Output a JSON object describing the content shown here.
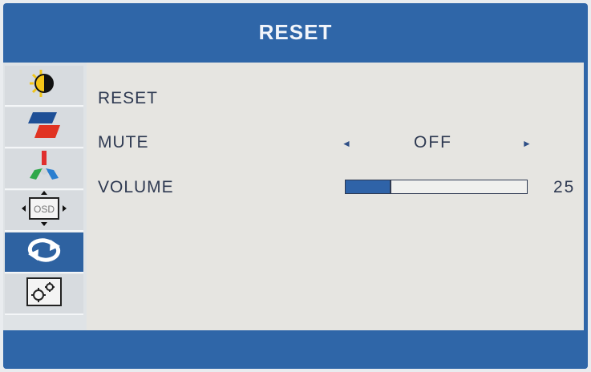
{
  "header": {
    "title": "RESET"
  },
  "sidebar": {
    "tabs": [
      {
        "icon": "brightness-contrast-icon",
        "active": false
      },
      {
        "icon": "picture-icon",
        "active": false
      },
      {
        "icon": "color-icon",
        "active": false
      },
      {
        "icon": "osd-icon",
        "osd_text": "OSD",
        "active": false
      },
      {
        "icon": "reset-icon",
        "active": true
      },
      {
        "icon": "settings-icon",
        "active": false
      }
    ]
  },
  "menu": {
    "reset": {
      "label": "RESET"
    },
    "mute": {
      "label": "MUTE",
      "value": "OFF"
    },
    "volume": {
      "label": "VOLUME",
      "value": "25",
      "level": 25
    }
  },
  "colors": {
    "frame": "#2f66a8",
    "panel": "#e6e5e1",
    "text": "#2f3a52",
    "accent": "#2f63a8"
  }
}
